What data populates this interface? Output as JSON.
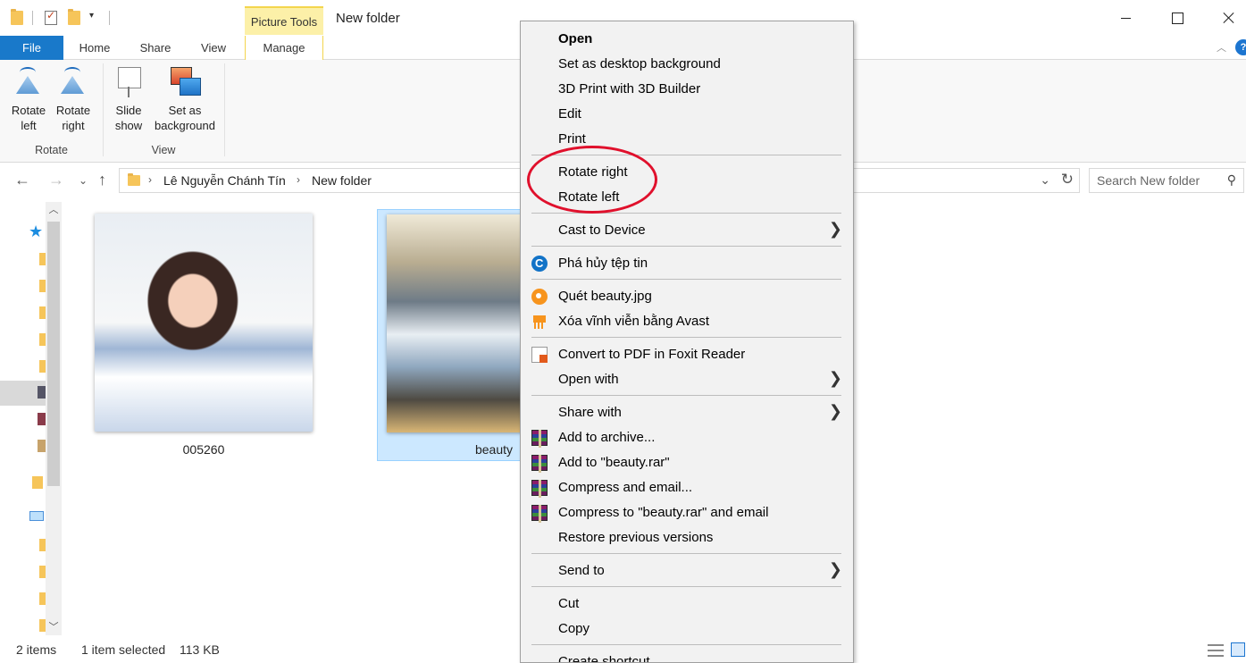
{
  "titlebar": {
    "picture_tools": "Picture Tools",
    "window_title": "New folder"
  },
  "ribbon_tabs": {
    "file": "File",
    "home": "Home",
    "share": "Share",
    "view": "View",
    "manage": "Manage"
  },
  "ribbon": {
    "rotate_left": [
      "Rotate",
      "left"
    ],
    "rotate_right": [
      "Rotate",
      "right"
    ],
    "slide_show": [
      "Slide",
      "show"
    ],
    "set_as_background": [
      "Set as",
      "background"
    ],
    "rotate_group": "Rotate",
    "view_group": "View"
  },
  "address": {
    "crumbs": [
      "Lê Nguyễn Chánh Tín",
      "New folder"
    ],
    "search_placeholder": "Search New folder"
  },
  "files": [
    {
      "name": "005260",
      "selected": false
    },
    {
      "name": "beauty",
      "selected": true
    }
  ],
  "status": {
    "items": "2 items",
    "selection": "1 item selected",
    "size": "113 KB"
  },
  "context_menu": {
    "open": "Open",
    "set_desktop_bg": "Set as desktop background",
    "print_3d": "3D Print with 3D Builder",
    "edit": "Edit",
    "print": "Print",
    "rotate_right": "Rotate right",
    "rotate_left": "Rotate left",
    "cast_to_device": "Cast to Device",
    "destroy_file": "Phá hủy tệp tin",
    "scan_file": "Quét beauty.jpg",
    "delete_avast": "Xóa vĩnh viễn bằng Avast",
    "convert_pdf": "Convert to PDF in Foxit Reader",
    "open_with": "Open with",
    "share_with": "Share with",
    "add_to_archive": "Add to archive...",
    "add_to_rar": "Add to \"beauty.rar\"",
    "compress_email": "Compress and email...",
    "compress_rar_email": "Compress to \"beauty.rar\" and email",
    "restore_versions": "Restore previous versions",
    "send_to": "Send to",
    "cut": "Cut",
    "copy": "Copy",
    "create_shortcut": "Create shortcut"
  },
  "icons": {
    "ccleaner": "ccleaner-icon",
    "avast": "avast-icon",
    "shredder": "shredder-icon",
    "foxit": "foxit-icon",
    "winrar": "winrar-icon",
    "submenu": "chevron-right-icon"
  },
  "colors": {
    "accent": "#1979ca",
    "picture_tools": "#fcf0a8",
    "selection": "#cce8ff",
    "annotation": "#e0102c"
  }
}
